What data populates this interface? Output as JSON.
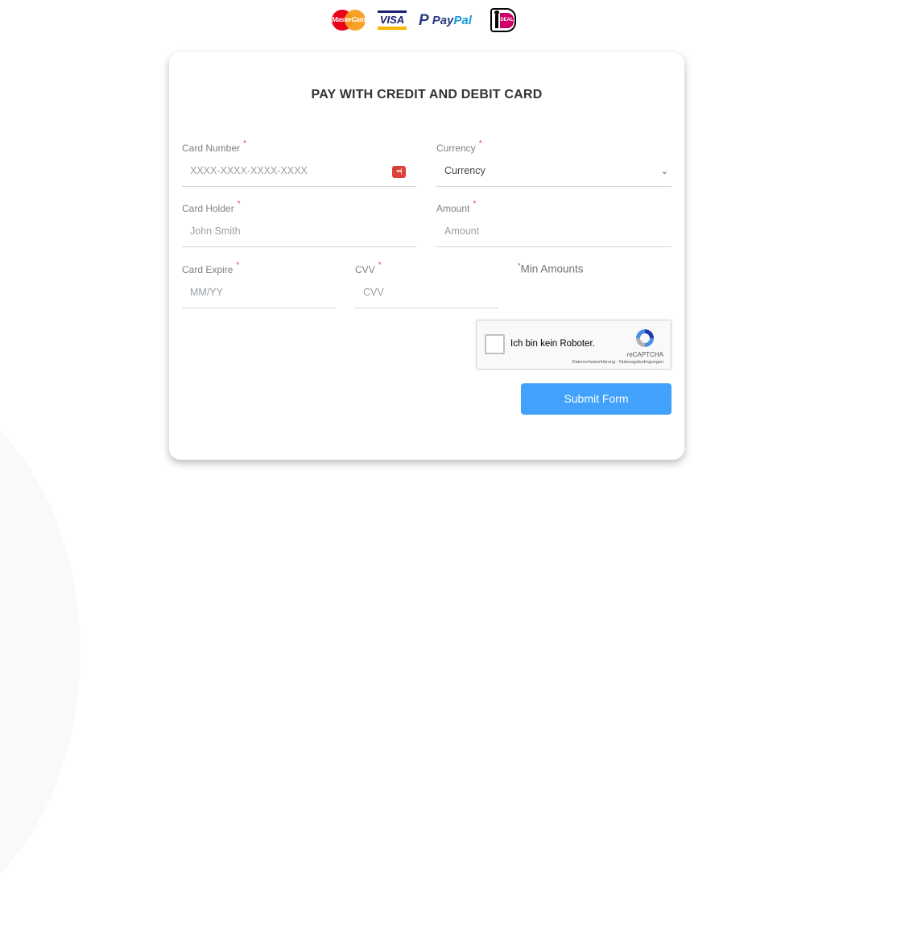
{
  "payment_logos": [
    {
      "name": "mastercard",
      "label": "MasterCard"
    },
    {
      "name": "visa",
      "label": "VISA"
    },
    {
      "name": "paypal",
      "label_a": "Pay",
      "label_b": "Pal",
      "icon": "P"
    },
    {
      "name": "ideal",
      "label": "iDEAL",
      "badge_text": "DEAL"
    }
  ],
  "form": {
    "title": "PAY WITH CREDIT AND DEBIT CARD",
    "required_marker": "*",
    "card_number": {
      "label": "Card Number",
      "placeholder": "XXXX-XXXX-XXXX-XXXX",
      "icon": "credit-card-icon",
      "icon_glyph": "•••|"
    },
    "currency": {
      "label": "Currency",
      "selected": "Currency",
      "chevron": "⌄"
    },
    "card_holder": {
      "label": "Card Holder",
      "placeholder": "John Smith"
    },
    "amount": {
      "label": "Amount",
      "placeholder": "Amount"
    },
    "card_expire": {
      "label": "Card Expire",
      "placeholder": "MM/YY"
    },
    "cvv": {
      "label": "CVV",
      "placeholder": "CVV"
    },
    "min_amounts": {
      "marker": "*",
      "text": "Min Amounts"
    },
    "recaptcha": {
      "checkbox_label": "Ich bin kein Roboter.",
      "brand": "reCAPTCHA",
      "privacy_link": "Datenschutzerklärung",
      "separator": "·",
      "terms_link": "Nutzungsbedingungen"
    },
    "submit_label": "Submit Form"
  },
  "colors": {
    "accent": "#42a1fb",
    "required": "#e4433f",
    "title": "#333333"
  }
}
